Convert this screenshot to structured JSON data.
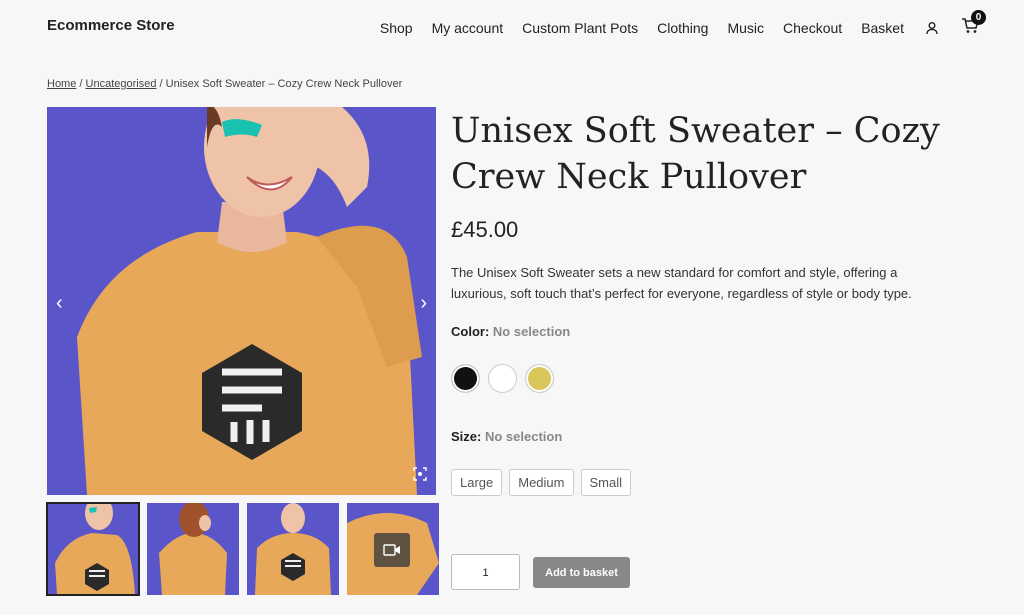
{
  "header": {
    "site_title": "Ecommerce Store",
    "nav": [
      "Shop",
      "My account",
      "Custom Plant Pots",
      "Clothing",
      "Music",
      "Checkout",
      "Basket"
    ],
    "cart_count": "0"
  },
  "breadcrumb": {
    "home": "Home",
    "category": "Uncategorised",
    "current": "Unisex Soft Sweater – Cozy Crew Neck Pullover"
  },
  "product": {
    "title": "Unisex Soft Sweater – Cozy Crew Neck Pullover",
    "price": "£45.00",
    "description": "The Unisex Soft Sweater sets a new standard for comfort and style, offering a luxurious, soft touch that’s perfect for everyone, regardless of style or body type.",
    "color_label": "Color:",
    "color_value": "No selection",
    "colors": [
      "#111111",
      "#ffffff",
      "#d9c65a"
    ],
    "size_label": "Size:",
    "size_value": "No selection",
    "sizes": [
      "Large",
      "Medium",
      "Small"
    ],
    "quantity": "1",
    "add_to_basket": "Add to basket"
  },
  "colors": {
    "background": "#f7f7f7",
    "image_bg": "#5a55c8",
    "sweater": "#e8a85a"
  }
}
